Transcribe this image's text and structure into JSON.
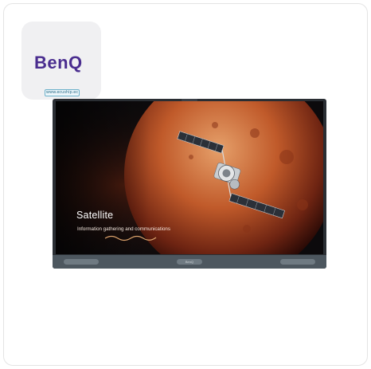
{
  "brand": {
    "logo_text": "BenQ",
    "url_badge": "www.ecuship.ec"
  },
  "screen": {
    "title": "Satellite",
    "subtitle": "Information gathering and communications"
  },
  "bezel": {
    "center_label": "BenQ"
  },
  "colors": {
    "brand_purple": "#4a2d8f",
    "badge_border": "#6bb0c9",
    "bezel": "#4d575f"
  }
}
